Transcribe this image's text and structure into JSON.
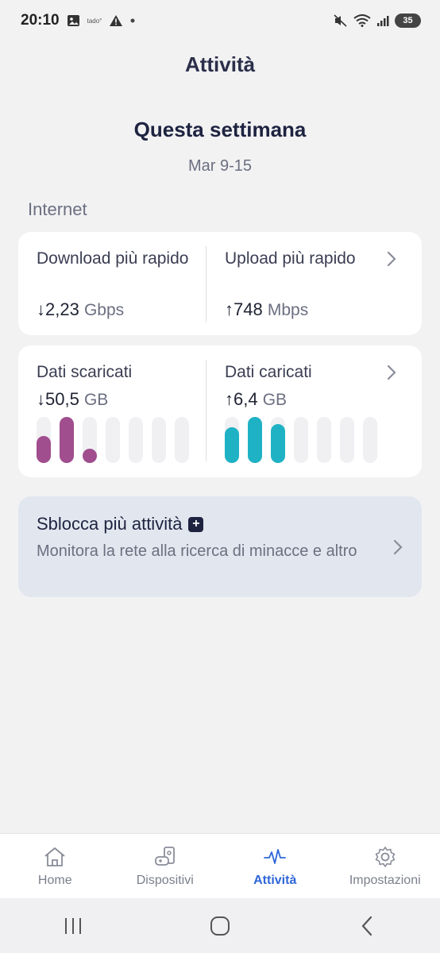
{
  "status_bar": {
    "time": "20:10",
    "notif_tado": "tado°",
    "battery": "35"
  },
  "page": {
    "title": "Attività",
    "week_title": "Questa settimana",
    "week_range": "Mar 9-15",
    "section_label": "Internet"
  },
  "speed_card": {
    "download_label": "Download più rapido",
    "download_arrow": "↓",
    "download_value": "2,23",
    "download_unit": "Gbps",
    "upload_label": "Upload più rapido",
    "upload_arrow": "↑",
    "upload_value": "748",
    "upload_unit": "Mbps"
  },
  "data_card": {
    "down_label": "Dati scaricati",
    "down_arrow": "↓",
    "down_value": "50,5",
    "down_unit": "GB",
    "up_label": "Dati caricati",
    "up_arrow": "↑",
    "up_value": "6,4",
    "up_unit": "GB",
    "down_bars": [
      0.58,
      1.0,
      0.3,
      0,
      0,
      0,
      0
    ],
    "up_bars": [
      0.78,
      1.0,
      0.85,
      0,
      0,
      0,
      0
    ],
    "down_color": "#a04e8e",
    "up_color": "#1fb2c4"
  },
  "promo": {
    "title": "Sblocca più attività",
    "badge": "+",
    "description": "Monitora la rete alla ricerca di minacce e altro"
  },
  "bottom_nav": {
    "items": [
      {
        "label": "Home",
        "icon": "home-icon"
      },
      {
        "label": "Dispositivi",
        "icon": "devices-icon"
      },
      {
        "label": "Attività",
        "icon": "activity-icon"
      },
      {
        "label": "Impostazioni",
        "icon": "settings-icon"
      }
    ],
    "active_color": "#2f66d8"
  }
}
